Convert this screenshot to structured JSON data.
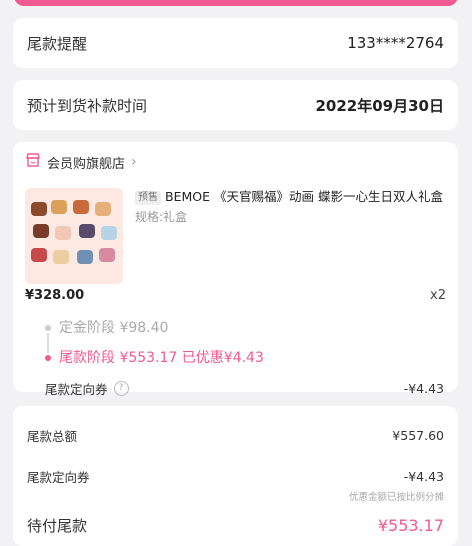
{
  "reminder": {
    "label": "尾款提醒",
    "phone": "133****2764"
  },
  "arrival": {
    "label": "预计到货补款时间",
    "date": "2022年09月30日"
  },
  "store": {
    "name": "会员购旗舰店",
    "icon": "shop-icon"
  },
  "product": {
    "tag": "预售",
    "title": "BEMOE 《天官赐福》动画 蝶影一心生日双人礼盒",
    "spec": "规格:礼盒",
    "price": "¥328.00",
    "qty": "x2"
  },
  "stages": {
    "deposit": "定金阶段 ¥98.40",
    "balance": "尾款阶段 ¥553.17 已优惠¥4.43"
  },
  "coupon": {
    "label": "尾款定向券",
    "value": "-¥4.43"
  },
  "summary": {
    "total_label": "尾款总额",
    "total_value": "¥557.60",
    "coupon_label": "尾款定向券",
    "coupon_value": "-¥4.43",
    "note": "优惠金额已按比例分摊",
    "due_label": "待付尾款",
    "due_value": "¥553.17"
  },
  "colors": {
    "accent": "#ef5a93",
    "price_pink": "#f05a8f",
    "bg": "#f2f2f4"
  }
}
